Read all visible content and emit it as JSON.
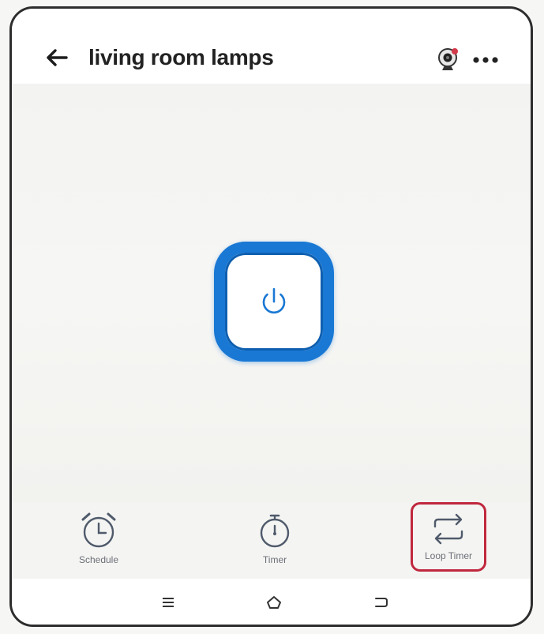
{
  "header": {
    "title": "living room lamps",
    "back_icon": "arrow-left-icon",
    "camera_icon": "camera-icon",
    "more_icon": "more-dots-icon"
  },
  "power": {
    "icon": "power-icon",
    "accent_color": "#1978d4"
  },
  "actions": [
    {
      "label": "Schedule",
      "icon": "alarm-clock-icon"
    },
    {
      "label": "Timer",
      "icon": "stopwatch-icon"
    },
    {
      "label": "Loop Timer",
      "icon": "loop-arrows-icon",
      "highlight_color": "#c0283e"
    }
  ],
  "nav": {
    "menu_icon": "menu-icon",
    "home_icon": "home-icon",
    "back_icon": "return-icon"
  }
}
